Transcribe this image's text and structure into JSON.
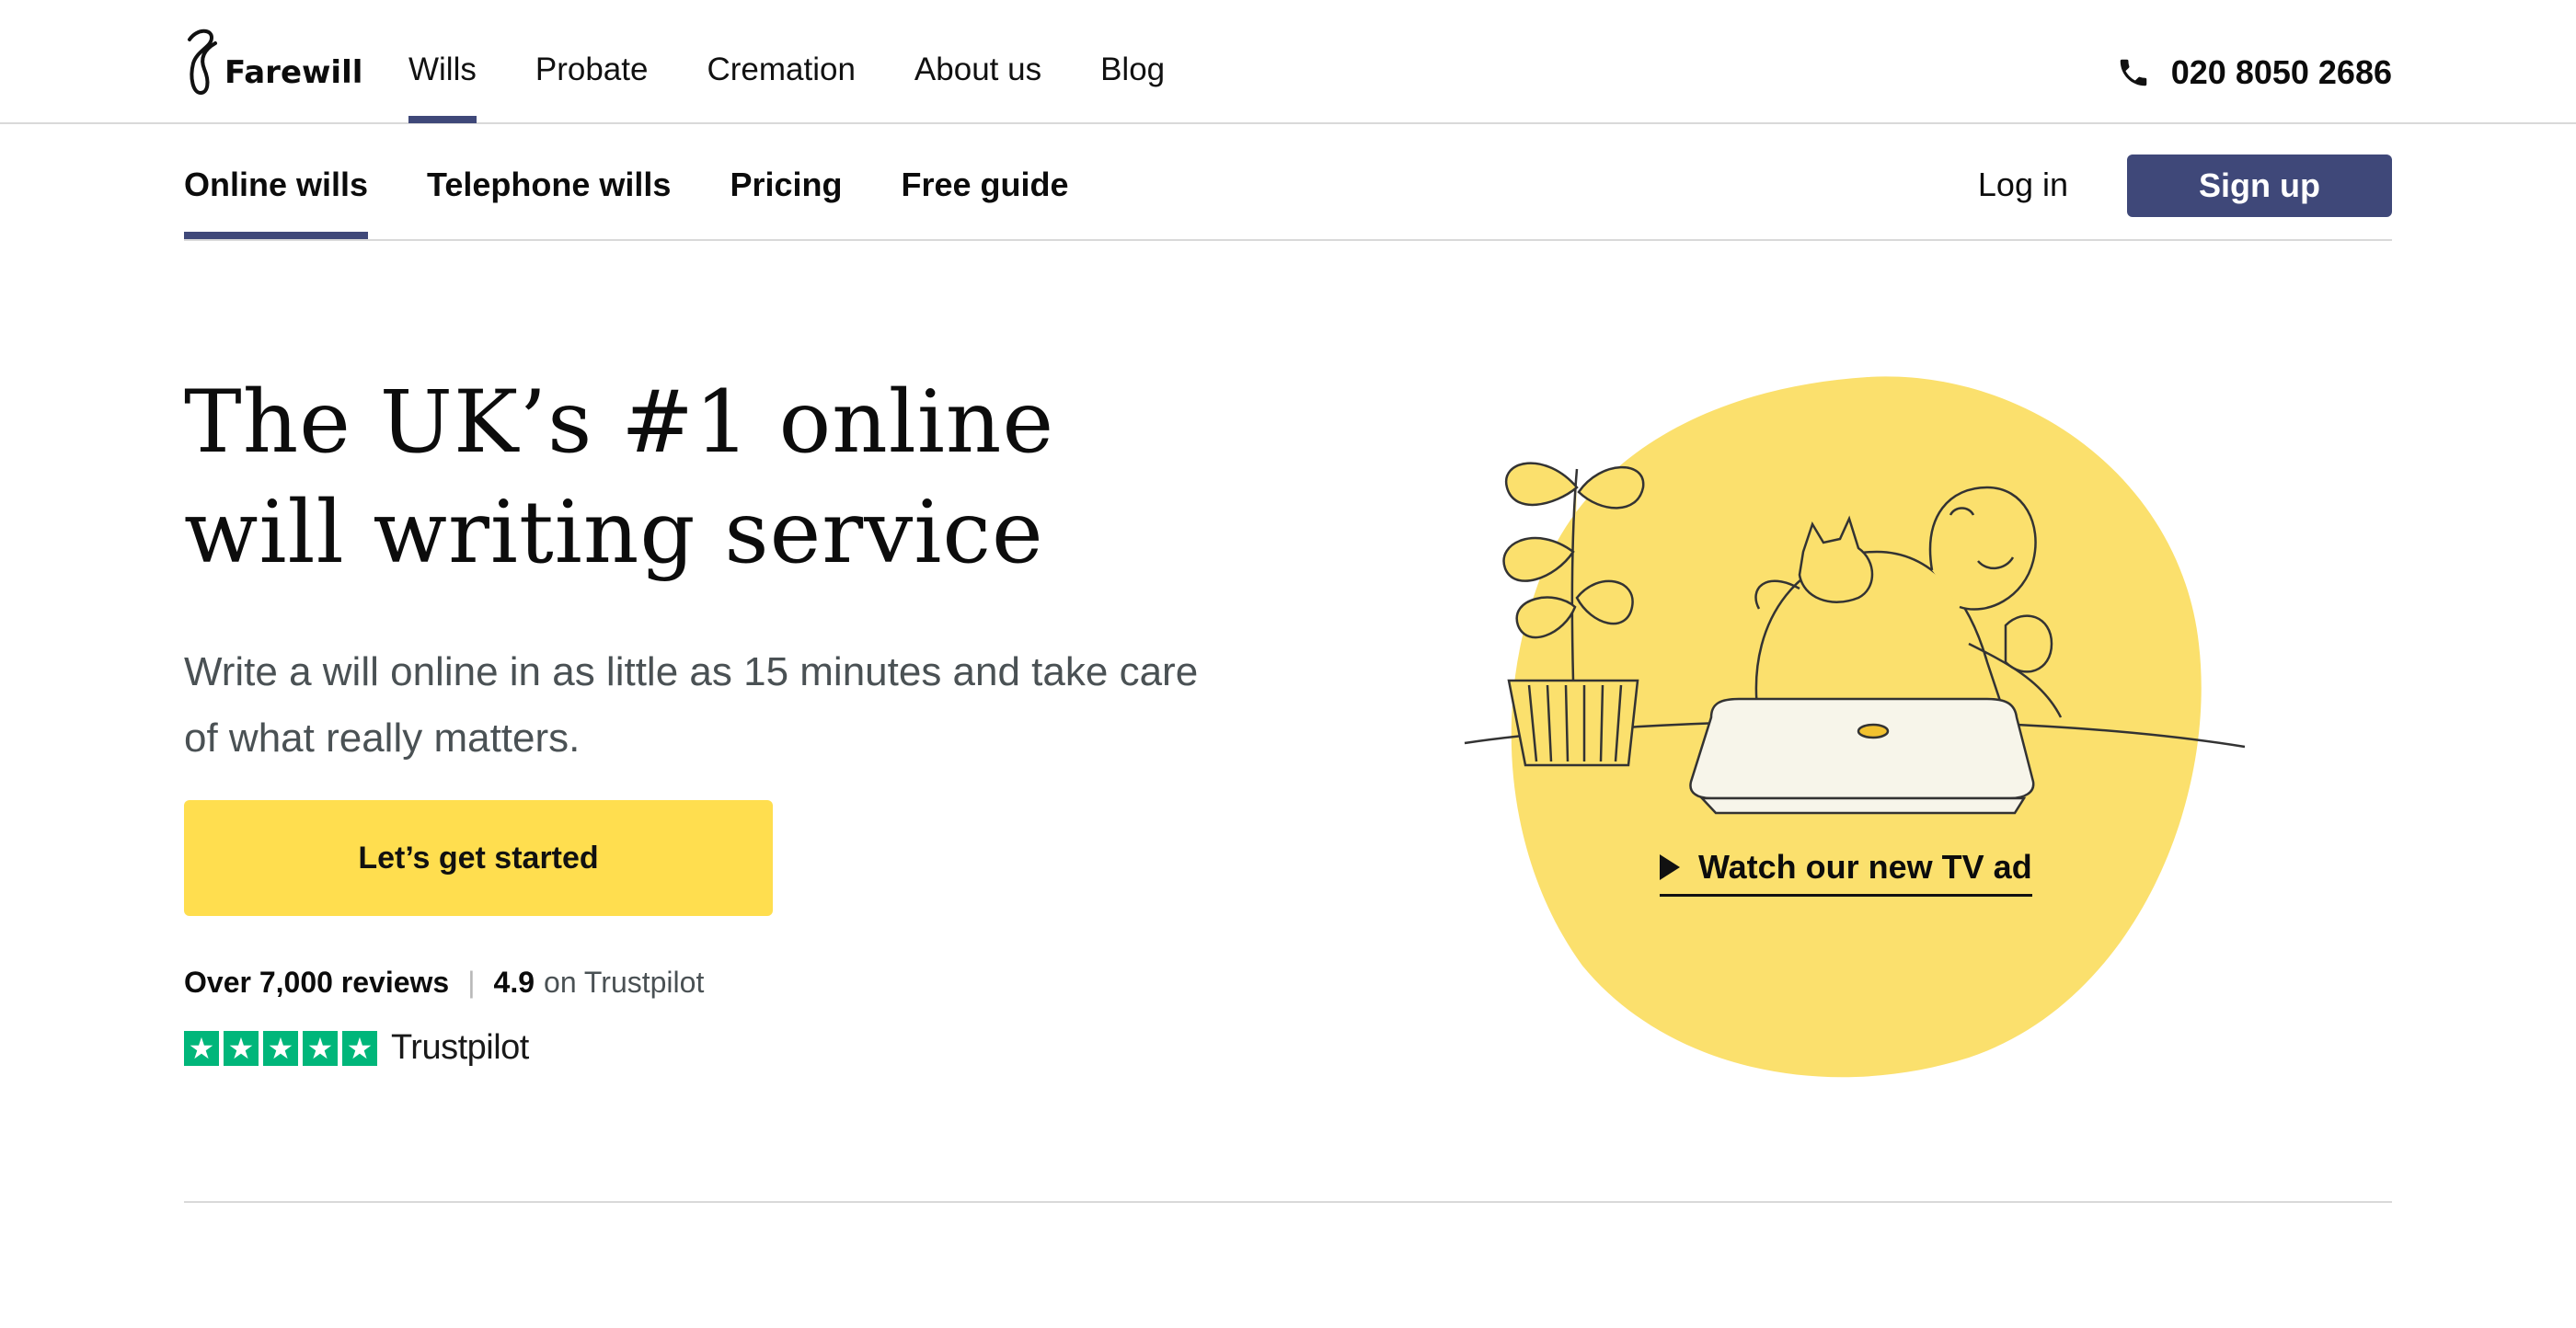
{
  "brand": {
    "name": "Farewill"
  },
  "main_nav": {
    "items": [
      {
        "label": "Wills",
        "active": true
      },
      {
        "label": "Probate",
        "active": false
      },
      {
        "label": "Cremation",
        "active": false
      },
      {
        "label": "About us",
        "active": false
      },
      {
        "label": "Blog",
        "active": false
      }
    ],
    "phone": "020 8050 2686"
  },
  "sub_nav": {
    "tabs": [
      {
        "label": "Online wills",
        "active": true
      },
      {
        "label": "Telephone wills",
        "active": false
      },
      {
        "label": "Pricing",
        "active": false
      },
      {
        "label": "Free guide",
        "active": false
      }
    ],
    "login_label": "Log in",
    "signup_label": "Sign up"
  },
  "hero": {
    "headline_line1": "The UK’s #1 online",
    "headline_line2": "will writing service",
    "subtitle": "Write a will online in as little as 15 minutes and take care of what really matters.",
    "cta_label": "Let’s get started",
    "reviews_count": "Over 7,000 reviews",
    "rating": "4.9",
    "rating_suffix": "on Trustpilot",
    "trustpilot_brand": "Trustpilot",
    "stars": 5,
    "tv_ad_label": "Watch our new TV ad"
  },
  "colors": {
    "accent": "#3f4879",
    "cta": "#ffde4f",
    "illustration_yellow": "#fbe06d",
    "trustpilot_green": "#00b67a",
    "muted_text": "#4a5154"
  }
}
